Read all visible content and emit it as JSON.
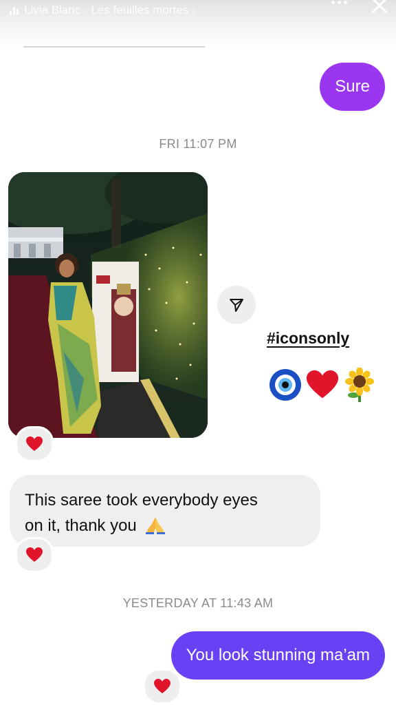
{
  "story_header": {
    "music_label": "Livia Blanc · Les feuilles mortes",
    "chevron_glyph": "›"
  },
  "messages": [
    {
      "id": "m1",
      "type": "text",
      "sender": "me",
      "text": "Sure",
      "bubble_color": "#9A36F0"
    },
    {
      "id": "t1",
      "type": "timestamp",
      "text": "FRI 11:07 PM"
    },
    {
      "id": "m2",
      "type": "story-reply",
      "sender": "them",
      "media": "photo",
      "hashtag": "#iconsonly",
      "sticker_icons": [
        "nazar-amulet-icon",
        "red-heart-icon",
        "sunflower-icon"
      ],
      "reaction": "red-heart-icon"
    },
    {
      "id": "m3",
      "type": "text",
      "sender": "them",
      "text_line1": "This saree took everybody eyes",
      "text_line2": "on it, thank you",
      "inline_icon": "folded-hands-icon",
      "reaction": "red-heart-icon"
    },
    {
      "id": "t2",
      "type": "timestamp",
      "text": "YESTERDAY AT 11:43 AM"
    },
    {
      "id": "m4",
      "type": "text",
      "sender": "me",
      "text": "You look stunning ma’am",
      "bubble_color": "#6941F4",
      "reaction": "red-heart-icon"
    }
  ],
  "colors": {
    "heart": "#E0142B",
    "timestamp_text": "#8A8A8A",
    "received_bubble": "#EFEFEF"
  }
}
